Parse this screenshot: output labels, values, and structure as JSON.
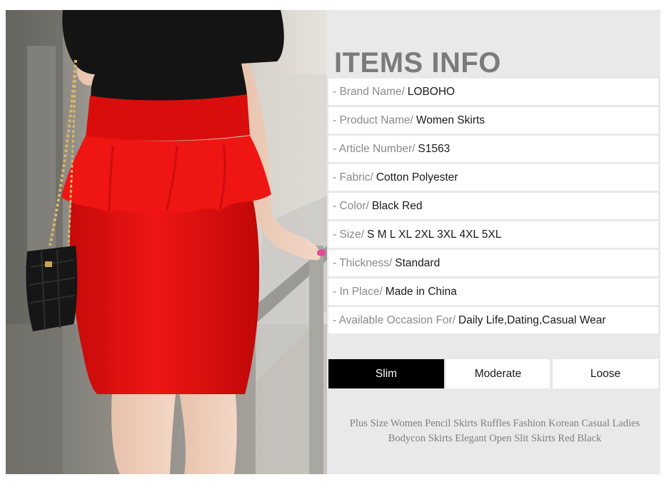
{
  "info": {
    "title": "ITEMS INFO",
    "rows": [
      {
        "key": "- Brand Name/",
        "value": "LOBOHO"
      },
      {
        "key": "- Product Name/",
        "value": "Women Skirts"
      },
      {
        "key": "- Article Number/",
        "value": "S1563"
      },
      {
        "key": "- Fabric/",
        "value": "Cotton Polyester"
      },
      {
        "key": "- Color/",
        "value": "Black Red"
      },
      {
        "key": "- Size/",
        "value": "S M L XL 2XL 3XL 4XL 5XL"
      },
      {
        "key": "- Thickness/",
        "value": "Standard"
      },
      {
        "key": "- In Place/",
        "value": "Made in China"
      },
      {
        "key": "- Available Occasion For/",
        "value": "Daily Life,Dating,Casual Wear"
      }
    ]
  },
  "fit": {
    "options": [
      "Slim",
      "Moderate",
      "Loose"
    ],
    "selected": "Slim"
  },
  "description": "Plus Size Women Pencil Skirts Ruffles Fashion Korean Casual Ladies Bodycon Skirts Elegant Open Slit Skirts Red Black",
  "colors": {
    "panel_bg": "#e9e9e9",
    "title": "#7b7b7b",
    "active_fit_bg": "#000000",
    "skirt_red": "#e3100f"
  }
}
